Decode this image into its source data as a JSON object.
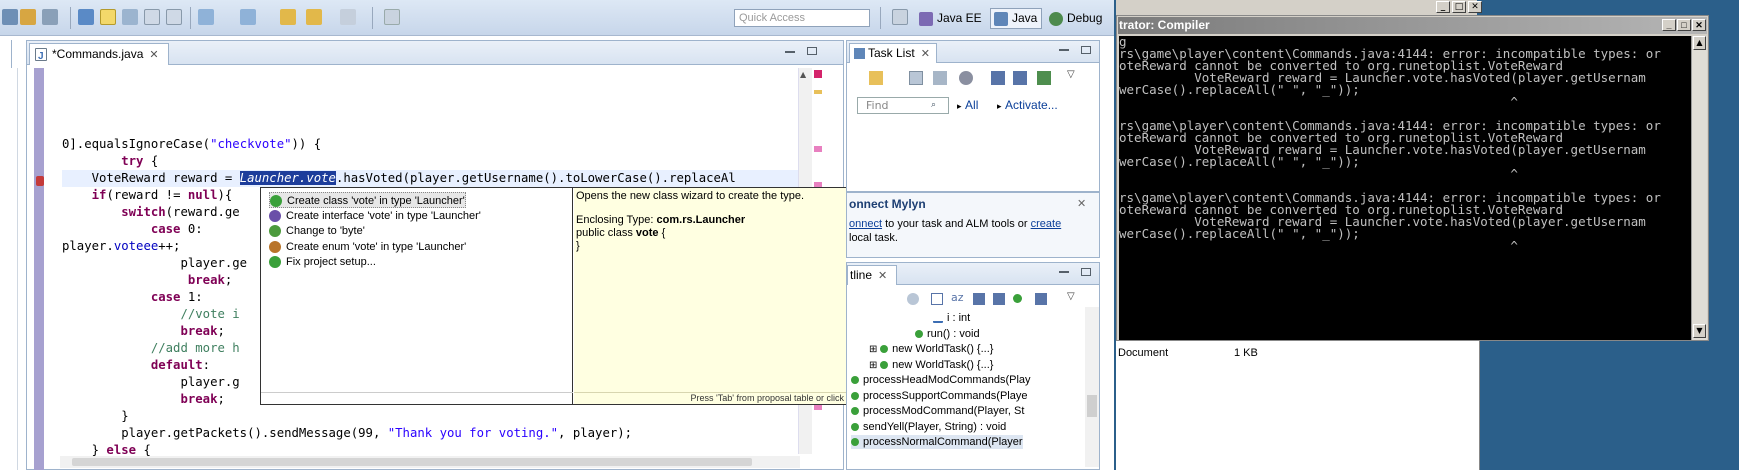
{
  "toolbar": {
    "quick_access_placeholder": "Quick Access",
    "perspectives": [
      {
        "label": "Java EE"
      },
      {
        "label": "Java"
      },
      {
        "label": "Debug"
      }
    ]
  },
  "editor": {
    "tab_label": "*Commands.java",
    "close_glyph": "✕",
    "code_lines": [
      {
        "segments": [
          {
            "t": "0].equalsIgnoreCase(",
            "c": ""
          },
          {
            "t": "\"checkvote\"",
            "c": "str"
          },
          {
            "t": ")) {",
            "c": ""
          }
        ]
      },
      {
        "segments": [
          {
            "t": "        ",
            "c": ""
          },
          {
            "t": "try",
            "c": "kw"
          },
          {
            "t": " {",
            "c": ""
          }
        ]
      },
      {
        "segments": [
          {
            "t": "    VoteReward reward = ",
            "c": ""
          },
          {
            "t": "Launcher.vote",
            "c": "sel"
          },
          {
            "t": ".hasVoted(player.getUsername().toLowerCase().replaceAl",
            "c": ""
          }
        ]
      },
      {
        "segments": [
          {
            "t": "    ",
            "c": ""
          },
          {
            "t": "if",
            "c": "kw"
          },
          {
            "t": "(reward != ",
            "c": ""
          },
          {
            "t": "null",
            "c": "kw"
          },
          {
            "t": "){",
            "c": ""
          }
        ]
      },
      {
        "segments": [
          {
            "t": "        ",
            "c": ""
          },
          {
            "t": "switch",
            "c": "kw"
          },
          {
            "t": "(reward.ge",
            "c": ""
          }
        ]
      },
      {
        "segments": [
          {
            "t": "            ",
            "c": ""
          },
          {
            "t": "case",
            "c": "kw"
          },
          {
            "t": " 0:",
            "c": ""
          }
        ]
      },
      {
        "segments": [
          {
            "t": "player.",
            "c": ""
          },
          {
            "t": "voteee",
            "c": "fld"
          },
          {
            "t": "++;",
            "c": ""
          }
        ]
      },
      {
        "segments": [
          {
            "t": "                player.ge",
            "c": ""
          }
        ]
      },
      {
        "segments": [
          {
            "t": "                 ",
            "c": ""
          },
          {
            "t": "break",
            "c": "kw"
          },
          {
            "t": ";",
            "c": ""
          }
        ]
      },
      {
        "segments": [
          {
            "t": "            ",
            "c": ""
          },
          {
            "t": "case",
            "c": "kw"
          },
          {
            "t": " 1:",
            "c": ""
          }
        ]
      },
      {
        "segments": [
          {
            "t": "                ",
            "c": ""
          },
          {
            "t": "//vote i",
            "c": "cm"
          }
        ]
      },
      {
        "segments": [
          {
            "t": "                ",
            "c": ""
          },
          {
            "t": "break",
            "c": "kw"
          },
          {
            "t": ";",
            "c": ""
          }
        ]
      },
      {
        "segments": [
          {
            "t": "            ",
            "c": ""
          },
          {
            "t": "//add more h",
            "c": "cm"
          }
        ]
      },
      {
        "segments": [
          {
            "t": "            ",
            "c": ""
          },
          {
            "t": "default",
            "c": "kw"
          },
          {
            "t": ":",
            "c": ""
          }
        ]
      },
      {
        "segments": [
          {
            "t": "                player.g",
            "c": ""
          }
        ]
      },
      {
        "segments": [
          {
            "t": "                ",
            "c": ""
          },
          {
            "t": "break",
            "c": "kw"
          },
          {
            "t": ";",
            "c": ""
          }
        ]
      },
      {
        "segments": [
          {
            "t": "        }",
            "c": ""
          }
        ]
      },
      {
        "segments": [
          {
            "t": "        player.getPackets().sendMessage(99, ",
            "c": ""
          },
          {
            "t": "\"Thank you for voting.\"",
            "c": "str"
          },
          {
            "t": ", player);",
            "c": ""
          }
        ]
      },
      {
        "segments": [
          {
            "t": "    } ",
            "c": ""
          },
          {
            "t": "else",
            "c": "kw"
          },
          {
            "t": " {",
            "c": ""
          }
        ]
      }
    ]
  },
  "quickfix": {
    "proposals": [
      {
        "label": "Create class 'vote' in type 'Launcher'",
        "icon": "class-icon",
        "color": "#3aa03a",
        "selected": true
      },
      {
        "label": "Create interface 'vote' in type 'Launcher'",
        "icon": "interface-icon",
        "color": "#6a4fa8",
        "selected": false
      },
      {
        "label": "Change to 'byte'",
        "icon": "change-icon",
        "color": "#4c9a3c",
        "selected": false
      },
      {
        "label": "Create enum 'vote' in type 'Launcher'",
        "icon": "enum-icon",
        "color": "#b8742a",
        "selected": false
      },
      {
        "label": "Fix project setup...",
        "icon": "setup-icon",
        "color": "#3aa03a",
        "selected": false
      }
    ],
    "doc": {
      "summary": "Opens the new class wizard to create the type.",
      "enclosing_label": "Enclosing Type: ",
      "enclosing_value": "com.rs.Launcher",
      "decl_prefix": "public class ",
      "decl_name": "vote",
      "decl_suffix": " {",
      "close_brace": "}",
      "status": "Press 'Tab' from proposal table or click for focus"
    }
  },
  "task_list": {
    "tab_label": "Task List",
    "find_placeholder": "Find",
    "all_label": "All",
    "activate_label": "Activate..."
  },
  "mylyn": {
    "title": "onnect Mylyn",
    "text_link": "onnect",
    "text_middle": " to your task and ALM tools or ",
    "text_link2": "create",
    "text_end": "local task."
  },
  "outline": {
    "tab_label": "tline",
    "items": [
      {
        "label": "i : int",
        "kind": "field"
      },
      {
        "label": "run() : void",
        "kind": "method"
      },
      {
        "label": "new WorldTask() {...}",
        "kind": "anon"
      },
      {
        "label": "new WorldTask() {...}",
        "kind": "anon"
      },
      {
        "label": "processHeadModCommands(Play",
        "kind": "static"
      },
      {
        "label": "processSupportCommands(Playe",
        "kind": "static"
      },
      {
        "label": "processModCommand(Player, St",
        "kind": "static"
      },
      {
        "label": "sendYell(Player, String) : void",
        "kind": "static"
      },
      {
        "label": "processNormalCommand(Player",
        "kind": "static"
      }
    ]
  },
  "console": {
    "title": "trator: Compiler",
    "lines": [
      "g",
      "rs\\game\\player\\content\\Commands.java:4144: error: incompatible types: or",
      "oteReward cannot be converted to org.runetoplist.VoteReward",
      "          VoteReward reward = Launcher.vote.hasVoted(player.getUsernam",
      "werCase().replaceAll(\" \", \"_\"));",
      "                                                    ^",
      "",
      "rs\\game\\player\\content\\Commands.java:4144: error: incompatible types: or",
      "oteReward cannot be converted to org.runetoplist.VoteReward",
      "          VoteReward reward = Launcher.vote.hasVoted(player.getUsernam",
      "werCase().replaceAll(\" \", \"_\"));",
      "                                                    ^",
      "",
      "rs\\game\\player\\content\\Commands.java:4144: error: incompatible types: or",
      "oteReward cannot be converted to org.runetoplist.VoteReward",
      "          VoteReward reward = Launcher.vote.hasVoted(player.getUsernam",
      "werCase().replaceAll(\" \", \"_\"));",
      "                                                    ^"
    ]
  },
  "explorer": {
    "type_label": "Document",
    "size_label": "1 KB"
  }
}
